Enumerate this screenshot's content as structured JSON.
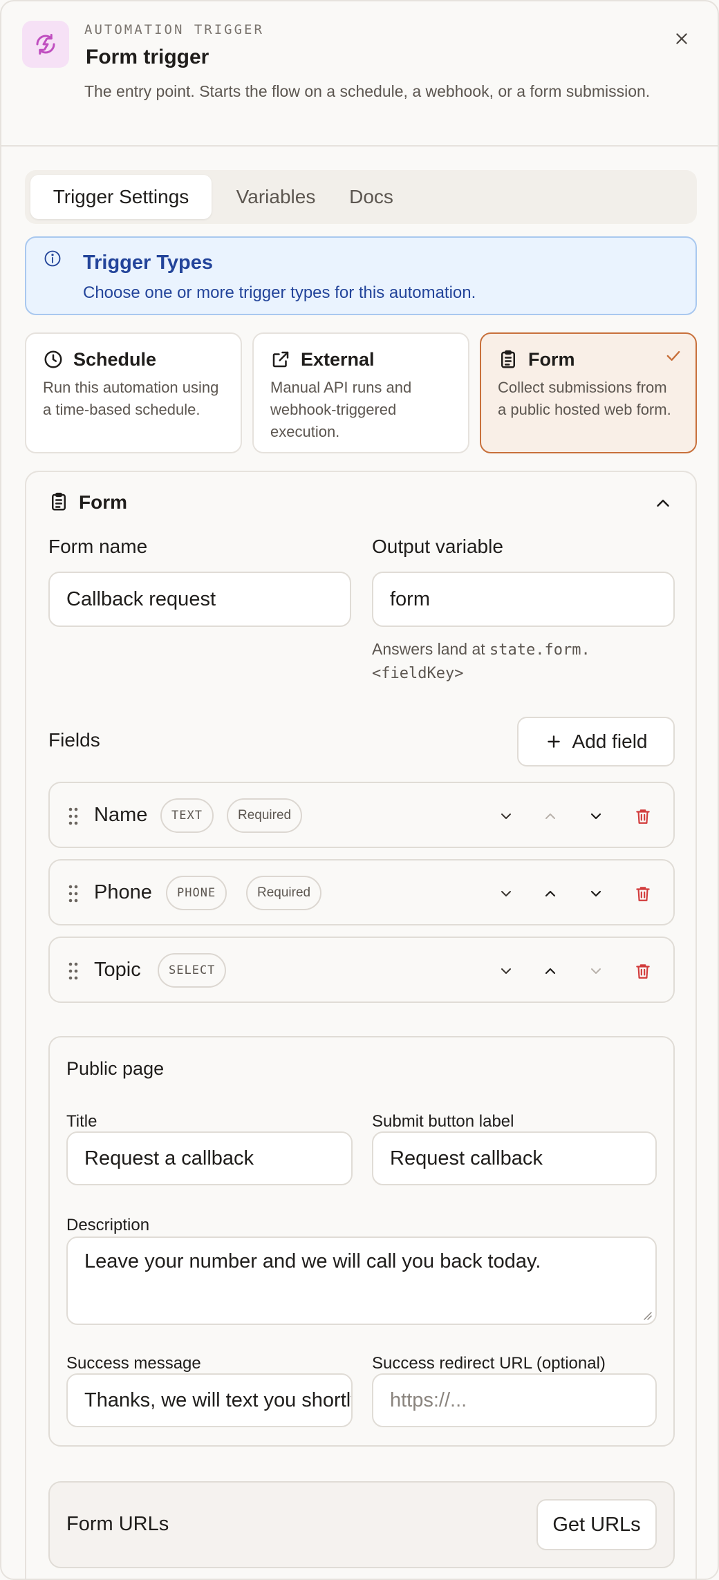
{
  "header": {
    "eyebrow": "AUTOMATION TRIGGER",
    "title": "Form trigger",
    "description": "The entry point. Starts the flow on a schedule, a webhook, or a form submission.",
    "icon": "bolt-refresh-icon",
    "accent": "#c04fc0"
  },
  "tabs": [
    {
      "label": "Trigger Settings",
      "active": true
    },
    {
      "label": "Variables",
      "active": false
    },
    {
      "label": "Docs",
      "active": false
    }
  ],
  "banner": {
    "title": "Trigger Types",
    "text": "Choose one or more trigger types for this automation.",
    "icon": "info-icon",
    "color": "#23449a"
  },
  "trigger_types": [
    {
      "title": "Schedule",
      "description": "Run this automation using a time-based schedule.",
      "icon": "clock-icon",
      "selected": false
    },
    {
      "title": "External",
      "description": "Manual API runs and webhook-triggered execution.",
      "icon": "external-link-icon",
      "selected": false
    },
    {
      "title": "Form",
      "description": "Collect submissions from a public hosted web form.",
      "icon": "clipboard-icon",
      "selected": true
    }
  ],
  "form_section": {
    "title": "Form",
    "form_name_label": "Form name",
    "form_name_value": "Callback request",
    "output_variable_label": "Output variable",
    "output_variable_value": "form",
    "hint_prefix": "Answers land at ",
    "hint_code": "state.form.<fieldKey>",
    "fields_label": "Fields",
    "add_field_label": "Add field"
  },
  "fields": [
    {
      "name": "Name",
      "type": "TEXT",
      "required": "Required"
    },
    {
      "name": "Phone",
      "type": "PHONE",
      "required": "Required"
    },
    {
      "name": "Topic",
      "type": "SELECT",
      "required": null
    }
  ],
  "public_page": {
    "title": "Public page",
    "title_label": "Title",
    "title_value": "Request a callback",
    "submit_label": "Submit button label",
    "submit_value": "Request callback",
    "description_label": "Description",
    "description_value": "Leave your number and we will call you back today.",
    "success_message_label": "Success message",
    "success_message_value": "Thanks, we will text you shortly.",
    "redirect_label": "Success redirect URL (optional)",
    "redirect_placeholder": "https://..."
  },
  "form_urls": {
    "title": "Form URLs",
    "button": "Get URLs"
  },
  "colors": {
    "danger": "#d23c3c",
    "selected_border": "#c8703b"
  }
}
